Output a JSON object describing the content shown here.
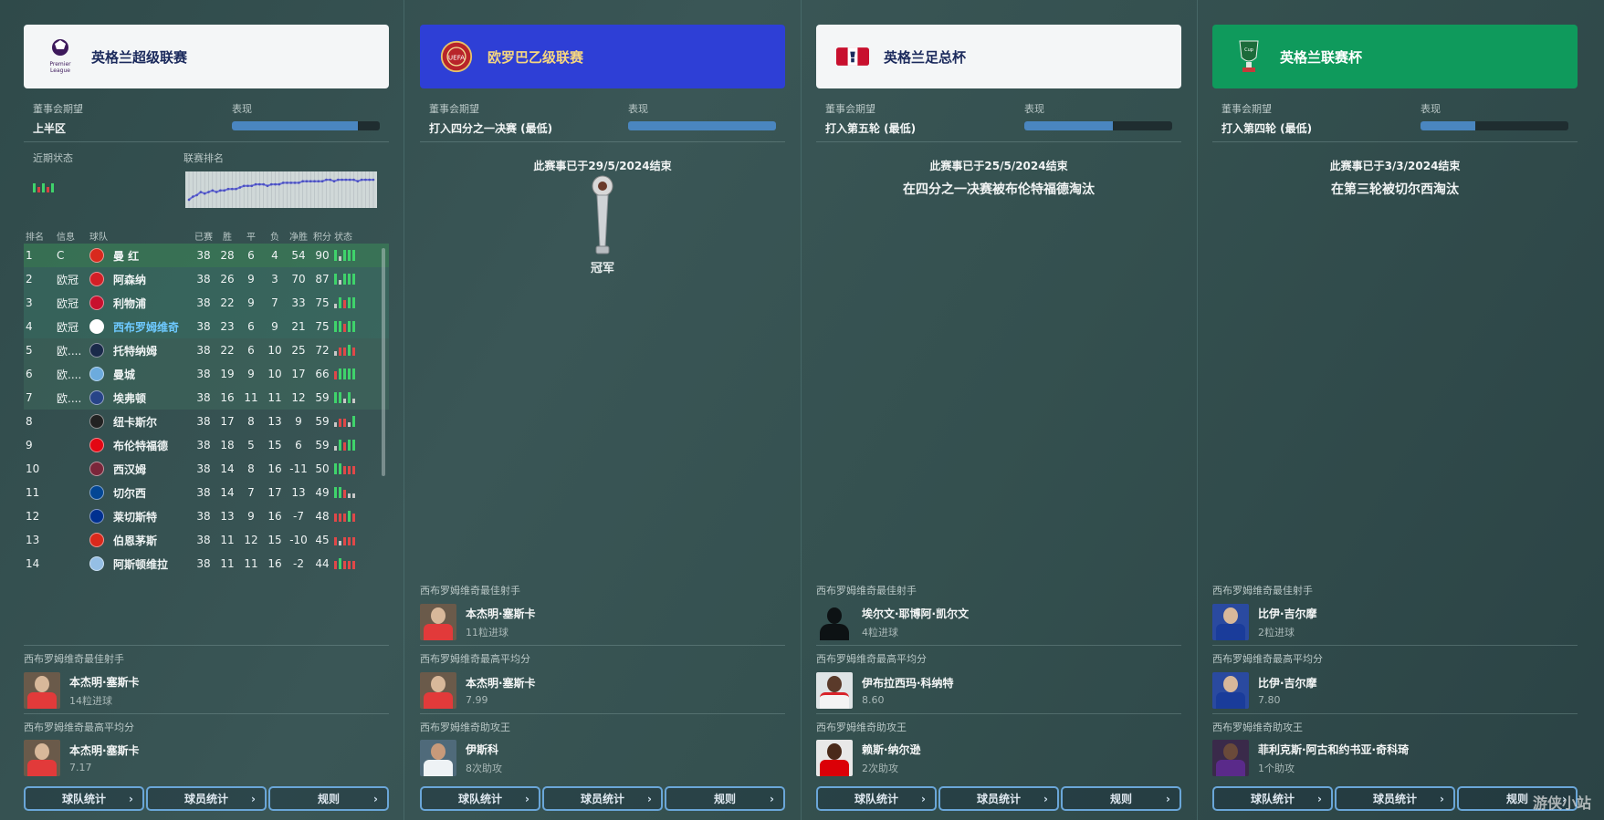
{
  "panels": [
    {
      "title": "英格兰超级联赛",
      "header_color": "#f4f6f7",
      "title_color": "#1b2a5c",
      "logo": "premier-league-logo",
      "logo_text": "Premier League",
      "expectation_label": "董事会期望",
      "expectation": "上半区",
      "performance_label": "表现",
      "performance": 0.85,
      "recent_form_label": "近期状态",
      "league_rank_label": "联赛排名",
      "table_headers": [
        "排名",
        "信息",
        "球队",
        "已赛",
        "胜",
        "平",
        "负",
        "净胜",
        "积分",
        "状态"
      ],
      "rows": [
        {
          "pos": "1",
          "info": "C",
          "team": "曼 红",
          "p": "38",
          "w": "28",
          "d": "6",
          "l": "4",
          "gd": "54",
          "pts": "90",
          "form": "wdwww",
          "crest": "#d8291d"
        },
        {
          "pos": "2",
          "info": "欧冠",
          "team": "阿森纳",
          "p": "38",
          "w": "26",
          "d": "9",
          "l": "3",
          "gd": "70",
          "pts": "87",
          "form": "wdwww",
          "crest": "#d21f26"
        },
        {
          "pos": "3",
          "info": "欧冠",
          "team": "利物浦",
          "p": "38",
          "w": "22",
          "d": "9",
          "l": "7",
          "gd": "33",
          "pts": "75",
          "form": "dwlww",
          "crest": "#c8102e"
        },
        {
          "pos": "4",
          "info": "欧冠",
          "team": "西布罗姆维奇",
          "p": "38",
          "w": "23",
          "d": "6",
          "l": "9",
          "gd": "21",
          "pts": "75",
          "form": "wwlww",
          "crest": "#ffffff",
          "highlight": true
        },
        {
          "pos": "5",
          "info": "欧....",
          "team": "托特纳姆",
          "p": "38",
          "w": "22",
          "d": "6",
          "l": "10",
          "gd": "25",
          "pts": "72",
          "form": "dllwl",
          "crest": "#1a2a4a"
        },
        {
          "pos": "6",
          "info": "欧....",
          "team": "曼城",
          "p": "38",
          "w": "19",
          "d": "9",
          "l": "10",
          "gd": "17",
          "pts": "66",
          "form": "lwwww",
          "crest": "#6cabdd"
        },
        {
          "pos": "7",
          "info": "欧....",
          "team": "埃弗顿",
          "p": "38",
          "w": "16",
          "d": "11",
          "l": "11",
          "gd": "12",
          "pts": "59",
          "form": "wwdwd",
          "crest": "#274488"
        },
        {
          "pos": "8",
          "info": "",
          "team": "纽卡斯尔",
          "p": "38",
          "w": "17",
          "d": "8",
          "l": "13",
          "gd": "9",
          "pts": "59",
          "form": "dlldw",
          "crest": "#222222"
        },
        {
          "pos": "9",
          "info": "",
          "team": "布伦特福德",
          "p": "38",
          "w": "18",
          "d": "5",
          "l": "15",
          "gd": "6",
          "pts": "59",
          "form": "dwlww",
          "crest": "#e30613"
        },
        {
          "pos": "10",
          "info": "",
          "team": "西汉姆",
          "p": "38",
          "w": "14",
          "d": "8",
          "l": "16",
          "gd": "-11",
          "pts": "50",
          "form": "wwlll",
          "crest": "#7a263a"
        },
        {
          "pos": "11",
          "info": "",
          "team": "切尔西",
          "p": "38",
          "w": "14",
          "d": "7",
          "l": "17",
          "gd": "13",
          "pts": "49",
          "form": "wwldd",
          "crest": "#034694"
        },
        {
          "pos": "12",
          "info": "",
          "team": "莱切斯特",
          "p": "38",
          "w": "13",
          "d": "9",
          "l": "16",
          "gd": "-7",
          "pts": "48",
          "form": "lllwl",
          "crest": "#003090"
        },
        {
          "pos": "13",
          "info": "",
          "team": "伯恩茅斯",
          "p": "38",
          "w": "11",
          "d": "12",
          "l": "15",
          "gd": "-10",
          "pts": "45",
          "form": "ldlll",
          "crest": "#da291c"
        },
        {
          "pos": "14",
          "info": "",
          "team": "阿斯顿维拉",
          "p": "38",
          "w": "11",
          "d": "11",
          "l": "16",
          "gd": "-2",
          "pts": "44",
          "form": "lwlll",
          "crest": "#95bfe5"
        }
      ],
      "rank_history": [
        17,
        15,
        14,
        12,
        13,
        12,
        11,
        12,
        11,
        11,
        10,
        10,
        10,
        9,
        8,
        8,
        8,
        7,
        7,
        7,
        8,
        7,
        7,
        7,
        6,
        6,
        6,
        6,
        6,
        5,
        5,
        5,
        5,
        5,
        5,
        4,
        4,
        5,
        4,
        4,
        4,
        4,
        4,
        5,
        4,
        4,
        4,
        4
      ],
      "stats": [
        {
          "label": "西布罗姆维奇最佳射手",
          "name": "本杰明·塞斯卡",
          "sub": "14粒进球",
          "avatar": "red"
        },
        {
          "label": "西布罗姆维奇最高平均分",
          "name": "本杰明·塞斯卡",
          "sub": "7.17",
          "avatar": "red"
        }
      ],
      "buttons": [
        "球队统计",
        "球员统计",
        "规则"
      ]
    },
    {
      "title": "欧罗巴乙级联赛",
      "header_color": "#2e3fd6",
      "title_color": "#f5d680",
      "logo": "uefa-logo",
      "logo_text": "UEFA",
      "expectation_label": "董事会期望",
      "expectation": "打入四分之一决赛 (最低)",
      "performance_label": "表现",
      "performance": 1.0,
      "end_message": "此赛事已于29/5/2024结束",
      "champion_label": "冠军",
      "stats": [
        {
          "label": "西布罗姆维奇最佳射手",
          "name": "本杰明·塞斯卡",
          "sub": "11粒进球",
          "avatar": "red"
        },
        {
          "label": "西布罗姆维奇最高平均分",
          "name": "本杰明·塞斯卡",
          "sub": "7.99",
          "avatar": "red"
        },
        {
          "label": "西布罗姆维奇助攻王",
          "name": "伊斯科",
          "sub": "8次助攻",
          "avatar": "white"
        }
      ],
      "buttons": [
        "球队统计",
        "球员统计",
        "规则"
      ]
    },
    {
      "title": "英格兰足总杯",
      "header_color": "#f4f6f7",
      "title_color": "#1b2a5c",
      "logo": "fa-cup-logo",
      "logo_text": "FA",
      "expectation_label": "董事会期望",
      "expectation": "打入第五轮 (最低)",
      "performance_label": "表现",
      "performance": 0.6,
      "end_message": "此赛事已于25/5/2024结束",
      "result_message": "在四分之一决赛被布伦特福德淘汰",
      "stats": [
        {
          "label": "西布罗姆维奇最佳射手",
          "name": "埃尔文·耶博阿·凯尔文",
          "sub": "4粒进球",
          "avatar": "silhouette"
        },
        {
          "label": "西布罗姆维奇最高平均分",
          "name": "伊布拉西玛·科纳特",
          "sub": "8.60",
          "avatar": "red"
        },
        {
          "label": "西布罗姆维奇助攻王",
          "name": "赖斯·纳尔逊",
          "sub": "2次助攻",
          "avatar": "arsenal"
        }
      ],
      "buttons": [
        "球队统计",
        "球员统计",
        "规则"
      ]
    },
    {
      "title": "英格兰联赛杯",
      "header_color": "#0f9a5c",
      "title_color": "#ffffff",
      "logo": "carabao-cup-logo",
      "logo_text": "Carabao Cup",
      "expectation_label": "董事会期望",
      "expectation": "打入第四轮 (最低)",
      "performance_label": "表现",
      "performance": 0.37,
      "end_message": "此赛事已于3/3/2024结束",
      "result_message": "在第三轮被切尔西淘汰",
      "stats": [
        {
          "label": "西布罗姆维奇最佳射手",
          "name": "比伊·吉尔摩",
          "sub": "2粒进球",
          "avatar": "blue"
        },
        {
          "label": "西布罗姆维奇最高平均分",
          "name": "比伊·吉尔摩",
          "sub": "7.80",
          "avatar": "blue"
        },
        {
          "label": "西布罗姆维奇助攻王",
          "name": "菲利克斯·阿古和约书亚·奇科琦",
          "sub": "1个助攻",
          "avatar": "purple"
        }
      ],
      "buttons": [
        "球队统计",
        "球员统计",
        "规则"
      ]
    }
  ],
  "watermark": "游侠小站"
}
